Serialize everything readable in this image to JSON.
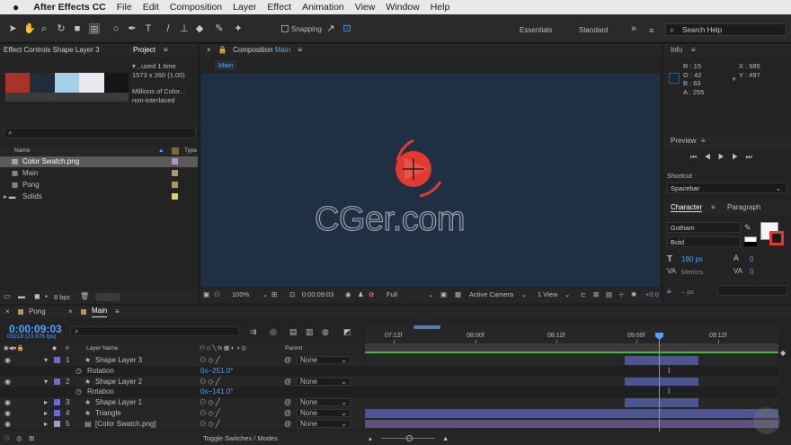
{
  "menubar": {
    "apple": "",
    "app": "After Effects CC",
    "items": [
      "File",
      "Edit",
      "Composition",
      "Layer",
      "Effect",
      "Animation",
      "View",
      "Window",
      "Help"
    ]
  },
  "toolbar": {
    "snapping": "Snapping",
    "workspaces": [
      "Essentials",
      "Standard"
    ],
    "more": "»",
    "search_placeholder": "Search Help"
  },
  "left_panel": {
    "effect_tab": "Effect Controls Shape Layer 3",
    "project_tab": "Project",
    "swatch_colors": [
      "#a7342a",
      "#1e2e3d",
      "#a6cfea",
      "#e8e8ee",
      "#151515"
    ],
    "info_lines": [
      "▾ , used 1 time",
      "1573 x 260 (1.00)",
      "",
      "Millions of Color...",
      "non-interlaced"
    ],
    "search_placeholder": "",
    "columns": {
      "name": "Name",
      "type": "Type"
    },
    "items": [
      {
        "name": "Color Swatch.png",
        "color": "#a699c8",
        "selected": true
      },
      {
        "name": "Main",
        "color": "#b0985d",
        "selected": false
      },
      {
        "name": "Pong",
        "color": "#b0985d",
        "selected": false
      },
      {
        "name": "Solids",
        "color": "#e2d05c",
        "selected": false
      }
    ],
    "bpc": "8 bpc"
  },
  "composition": {
    "tab_prefix": "Composition",
    "tab_name": "Main",
    "sub_tab": "Main",
    "canvas_color": "#1f3044",
    "shape_color": "#e23a2e",
    "watermark": "CGer.com",
    "footer": {
      "zoom": "100%",
      "timecode": "0:00:09:03",
      "resolution": "Full",
      "camera": "Active Camera",
      "view": "1 View",
      "plus": "+0.0"
    }
  },
  "info": {
    "title": "Info",
    "r": "R : 15",
    "g": "G : 42",
    "b": "B : 63",
    "a": "A : 255",
    "x": "X : 985",
    "y": "Y : 497",
    "swatch": "#0f2a3f"
  },
  "preview": {
    "title": "Preview",
    "shortcut_label": "Shortcut",
    "shortcut_value": "Spacebar"
  },
  "character": {
    "tab": "Character",
    "tab2": "Paragraph",
    "font": "Gotham",
    "style": "Bold",
    "size": "190 px",
    "metrics": "Metrics",
    "tracking": "0",
    "kern": "0",
    "leading_unit": "– px"
  },
  "timeline": {
    "tabs": [
      {
        "name": "Pong",
        "color": "#b0985d"
      },
      {
        "name": "Main",
        "color": "#b0985d"
      }
    ],
    "timecode": "0:00:09:03",
    "frames": "00219 (23.976 fps)",
    "columns": {
      "num": "#",
      "name": "Layer Name",
      "parent": "Parent"
    },
    "ruler": [
      "07:12f",
      "08:00f",
      "08:12f",
      "09:00f",
      "09:12f"
    ],
    "toggle": "Toggle Switches / Modes",
    "rows": [
      {
        "num": "1",
        "name": "Shape Layer 3",
        "parent": "None",
        "color": "#6c6ccf",
        "bar_color": "#4c5590",
        "star": true,
        "bar": "short"
      },
      {
        "num": "",
        "name": "Rotation",
        "parent": "",
        "value": "0x−251.0°",
        "sub": true
      },
      {
        "num": "2",
        "name": "Shape Layer 2",
        "parent": "None",
        "color": "#6c6ccf",
        "bar_color": "#4c5590",
        "star": true,
        "bar": "short"
      },
      {
        "num": "",
        "name": "Rotation",
        "parent": "",
        "value": "0x−141.0°",
        "sub": true
      },
      {
        "num": "3",
        "name": "Shape Layer 1",
        "parent": "None",
        "color": "#6c6ccf",
        "bar_color": "#4c5590",
        "star": true,
        "bar": "short"
      },
      {
        "num": "4",
        "name": "Triangle",
        "parent": "None",
        "color": "#6c6ccf",
        "bar_color": "#4c5590",
        "star": true,
        "bar": "full"
      },
      {
        "num": "5",
        "name": "[Color Swatch.png]",
        "parent": "None",
        "color": "#a699c8",
        "bar_color": "#5a527a",
        "star": false,
        "bar": "full"
      }
    ]
  }
}
